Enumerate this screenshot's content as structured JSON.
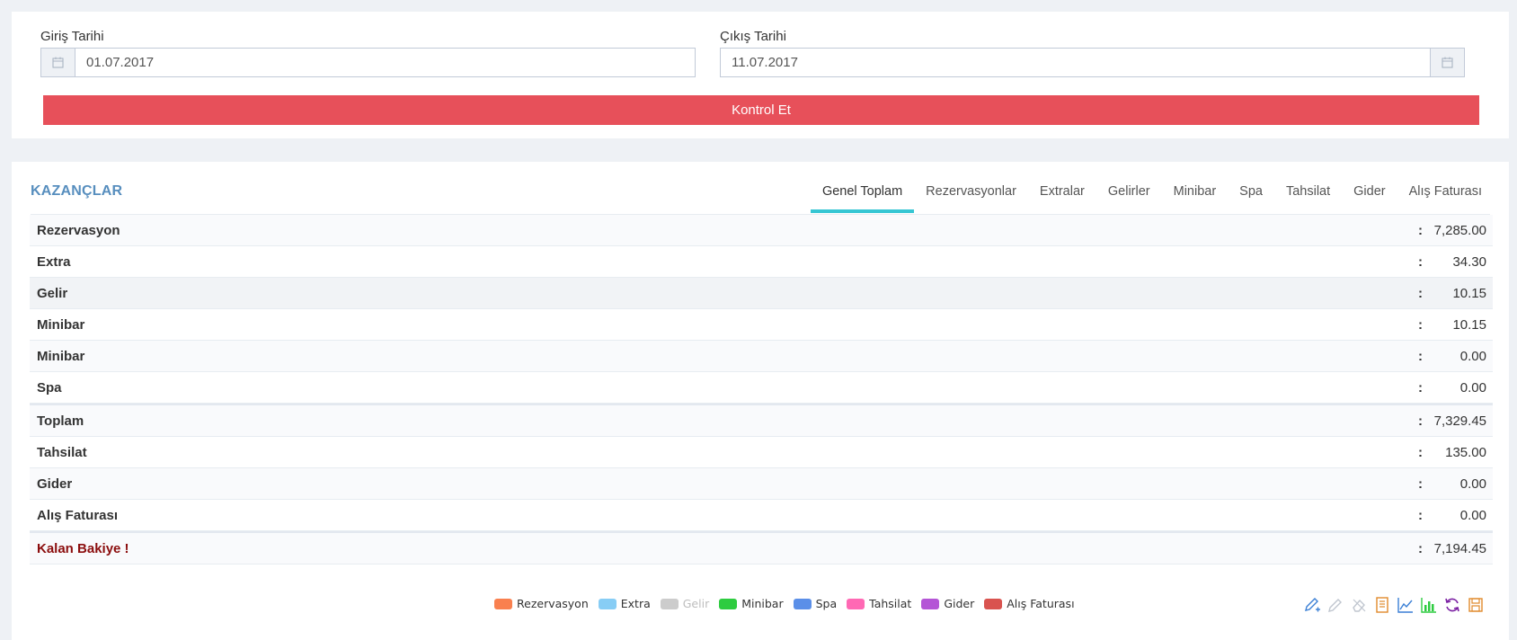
{
  "filters": {
    "checkin": {
      "label": "Giriş Tarihi",
      "value": "01.07.2017"
    },
    "checkout": {
      "label": "Çıkış Tarihi",
      "value": "11.07.2017"
    },
    "submit_label": "Kontrol Et"
  },
  "earnings": {
    "title": "KAZANÇLAR",
    "tabs": [
      {
        "label": "Genel Toplam",
        "active": true
      },
      {
        "label": "Rezervasyonlar"
      },
      {
        "label": "Extralar"
      },
      {
        "label": "Gelirler"
      },
      {
        "label": "Minibar"
      },
      {
        "label": "Spa"
      },
      {
        "label": "Tahsilat"
      },
      {
        "label": "Gider"
      },
      {
        "label": "Alış Faturası"
      }
    ],
    "rows": [
      {
        "label": "Rezervasyon",
        "colon": ":",
        "value": "7,285.00"
      },
      {
        "label": "Extra",
        "colon": ":",
        "value": "34.30"
      },
      {
        "label": "Gelir",
        "colon": ":",
        "value": "10.15"
      },
      {
        "label": "Minibar",
        "colon": ":",
        "value": "10.15"
      },
      {
        "label": "Minibar",
        "colon": ":",
        "value": "0.00"
      },
      {
        "label": "Spa",
        "colon": ":",
        "value": "0.00"
      },
      {
        "label": "Toplam",
        "colon": ":",
        "value": "7,329.45"
      },
      {
        "label": "Tahsilat",
        "colon": ":",
        "value": "135.00"
      },
      {
        "label": "Gider",
        "colon": ":",
        "value": "0.00"
      },
      {
        "label": "Alış Faturası",
        "colon": ":",
        "value": "0.00"
      },
      {
        "label": "Kalan Bakiye !",
        "colon": ":",
        "value": "7,194.45"
      }
    ]
  },
  "legend": [
    {
      "label": "Rezervasyon",
      "color": "#f9804f"
    },
    {
      "label": "Extra",
      "color": "#87cdf5"
    },
    {
      "label": "Gelir",
      "color": "#cccccc"
    },
    {
      "label": "Minibar",
      "color": "#2ecc40"
    },
    {
      "label": "Spa",
      "color": "#5b8fe8"
    },
    {
      "label": "Tahsilat",
      "color": "#ff69b4"
    },
    {
      "label": "Gider",
      "color": "#b455d6"
    },
    {
      "label": "Alış Faturası",
      "color": "#d9534f"
    }
  ],
  "toolbar_icons": [
    "edit-add-icon",
    "edit-icon",
    "erase-icon",
    "document-icon",
    "line-chart-icon",
    "bar-chart-icon",
    "refresh-icon",
    "save-icon"
  ],
  "colors": {
    "accent": "#e7505a",
    "title": "#578ebe",
    "tab_active": "#36c6d3",
    "danger_text": "#8b0d0d"
  }
}
